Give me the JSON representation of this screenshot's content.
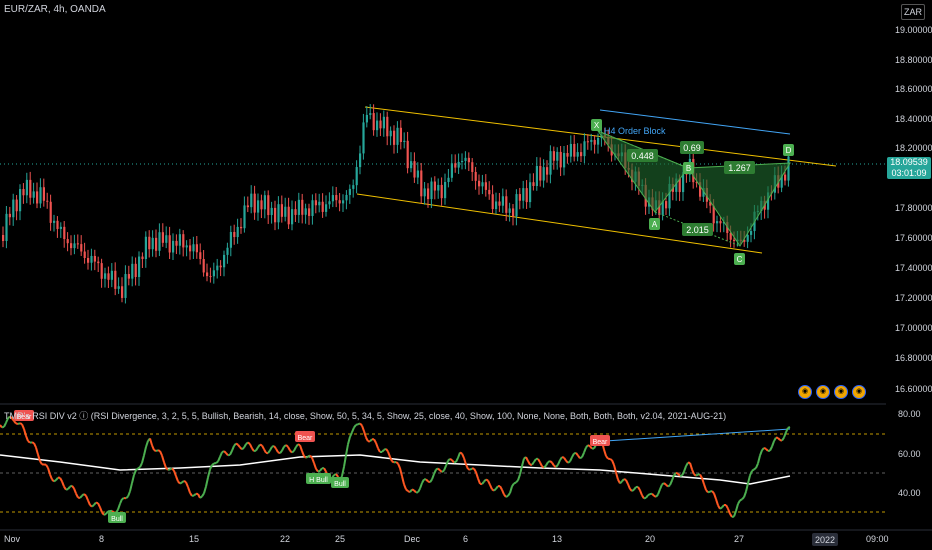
{
  "header": {
    "symbol": "EUR/ZAR, 4h, OANDA",
    "currency": "ZAR"
  },
  "price_axis": [
    "19.00000",
    "18.80000",
    "18.60000",
    "18.40000",
    "18.20000",
    "17.80000",
    "17.60000",
    "17.40000",
    "17.20000",
    "17.00000",
    "16.80000",
    "16.60000"
  ],
  "current_price": {
    "value": "18.09539",
    "countdown": "03:01:09"
  },
  "indicator": {
    "legend": "TMR's RSI DIV v2 ⓘ (RSI Divergence, 3, 2, 5, 5, Bullish, Bearish, 14, close, Show, 50, 5, 34, 5, Show, 25, close, 40, Show, 100, None, None, Both, Both, Both, v2.04, 2021-AUG-21)",
    "axis": [
      "80.00",
      "60.00",
      "40.00"
    ],
    "labels": {
      "bear": "Bear",
      "bull": "Bull",
      "hbull": "H Bull"
    }
  },
  "time_axis": [
    "Nov",
    "8",
    "15",
    "22",
    "25",
    "Dec",
    "6",
    "13",
    "20",
    "27",
    "2022",
    "09:00"
  ],
  "pattern": {
    "points": {
      "x": "X",
      "a": "A",
      "b": "B",
      "c": "C",
      "d": "D"
    },
    "ratios": {
      "xb": "0.448",
      "ac": "0.69",
      "bd": "1.267",
      "xd": "2.015"
    },
    "order_block": "H4 Order Block"
  },
  "colors": {
    "up": "#26a69a",
    "down": "#ef5350",
    "channel": "#f0c000",
    "pattern_fill": "#1f6b2f",
    "rsi_up": "#4caf50",
    "rsi_down": "#ff5722",
    "ma": "#ffffff",
    "trend": "#42a5f5"
  }
}
